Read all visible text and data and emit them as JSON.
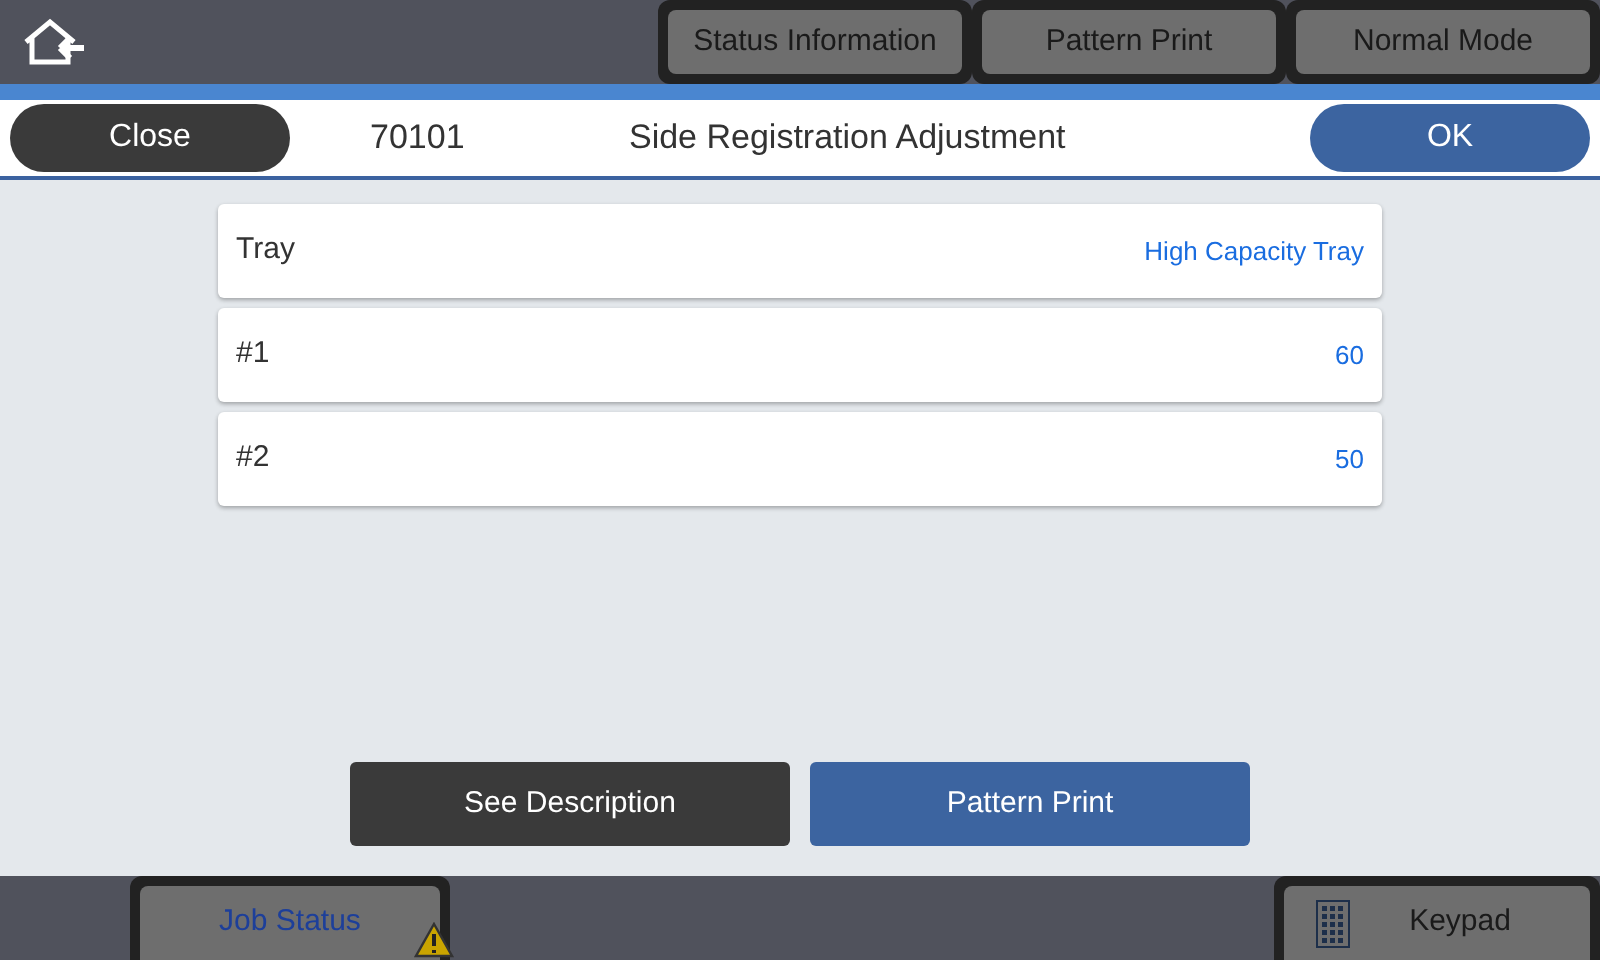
{
  "top_bar": {
    "buttons": [
      "Status Information",
      "Pattern Print",
      "Normal Mode"
    ]
  },
  "header": {
    "close": "Close",
    "code": "70101",
    "title": "Side Registration Adjustment",
    "ok": "OK"
  },
  "settings": [
    {
      "label": "Tray",
      "value": "High Capacity Tray"
    },
    {
      "label": "#1",
      "value": "60"
    },
    {
      "label": "#2",
      "value": "50"
    }
  ],
  "actions": [
    {
      "label": "See Description",
      "kind": "secondary"
    },
    {
      "label": "Pattern Print",
      "kind": "primary"
    }
  ],
  "bottom_bar": {
    "job_status": {
      "label": "Job Status",
      "warning": true
    },
    "keypad": "Keypad"
  }
}
